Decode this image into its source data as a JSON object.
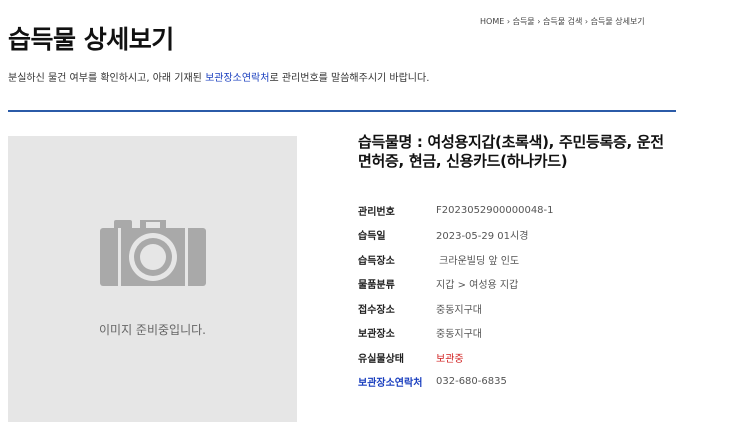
{
  "breadcrumb": {
    "home": "HOME",
    "lost_items": "습득물",
    "search": "습득물 검색",
    "detail": "습득물 상세보기",
    "separator": "›"
  },
  "page": {
    "title": "습득물 상세보기",
    "intro_before": "분실하신 물건 여부를 확인하시고, 아래 기재된 ",
    "intro_link": "보관장소연락처",
    "intro_after": "로 관리번호를 말씀해주시기 바랍니다."
  },
  "photo": {
    "icon": "camera-icon",
    "caption": "이미지 준비중입니다."
  },
  "item": {
    "title": "습득물명 : 여성용지갑(초록색), 주민등록증, 운전면허증, 현금, 신용카드(하나카드)"
  },
  "details": [
    {
      "label": "관리번호",
      "value": "F2023052900000048-1"
    },
    {
      "label": "습득일",
      "value": "2023-05-29 01시경"
    },
    {
      "label": "습득장소",
      "value": " 크라운빌딩 앞 인도"
    },
    {
      "label": "물품분류",
      "value": "지갑 > 여성용 지갑"
    },
    {
      "label": "접수장소",
      "value": "중동지구대"
    },
    {
      "label": "보관장소",
      "value": "중동지구대"
    },
    {
      "label": "유실물상태",
      "value": "보관중"
    },
    {
      "label": "보관장소연락처",
      "value": "032-680-6835"
    }
  ],
  "colors": {
    "accent": "#2b5ba8",
    "link": "#1a3fbf",
    "status": "#d11f1f",
    "photo_bg": "#e6e6e6"
  }
}
